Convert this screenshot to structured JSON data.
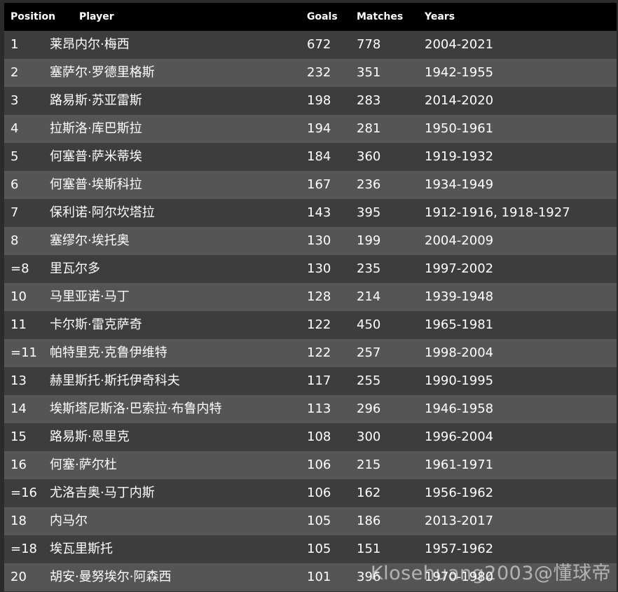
{
  "table": {
    "headers": {
      "position": "Position",
      "player": "Player",
      "goals": "Goals",
      "matches": "Matches",
      "years": "Years"
    },
    "rows": [
      {
        "position": "1",
        "player": "莱昂内尔·梅西",
        "goals": "672",
        "matches": "778",
        "years": "2004-2021"
      },
      {
        "position": "2",
        "player": "塞萨尔·罗德里格斯",
        "goals": "232",
        "matches": "351",
        "years": "1942-1955"
      },
      {
        "position": "3",
        "player": "路易斯·苏亚雷斯",
        "goals": "198",
        "matches": "283",
        "years": "2014-2020"
      },
      {
        "position": "4",
        "player": "拉斯洛·库巴斯拉",
        "goals": "194",
        "matches": "281",
        "years": "1950-1961"
      },
      {
        "position": "5",
        "player": "何塞普·萨米蒂埃",
        "goals": "184",
        "matches": "360",
        "years": "1919-1932"
      },
      {
        "position": "6",
        "player": "何塞普·埃斯科拉",
        "goals": "167",
        "matches": "236",
        "years": "1934-1949"
      },
      {
        "position": "7",
        "player": "保利诺·阿尔坎塔拉",
        "goals": "143",
        "matches": "395",
        "years": "1912-1916, 1918-1927"
      },
      {
        "position": "8",
        "player": "塞缪尔·埃托奥",
        "goals": "130",
        "matches": "199",
        "years": "2004-2009"
      },
      {
        "position": "=8",
        "player": "里瓦尔多",
        "goals": "130",
        "matches": "235",
        "years": "1997-2002"
      },
      {
        "position": "10",
        "player": "马里亚诺·马丁",
        "goals": "128",
        "matches": "214",
        "years": "1939-1948"
      },
      {
        "position": "11",
        "player": "卡尔斯·雷克萨奇",
        "goals": "122",
        "matches": "450",
        "years": "1965-1981"
      },
      {
        "position": "=11",
        "player": "帕特里克·克鲁伊维特",
        "goals": "122",
        "matches": "257",
        "years": "1998-2004"
      },
      {
        "position": "13",
        "player": "赫里斯托·斯托伊奇科夫",
        "goals": "117",
        "matches": "255",
        "years": "1990-1995"
      },
      {
        "position": "14",
        "player": "埃斯塔尼斯洛·巴索拉·布鲁内特",
        "goals": "113",
        "matches": "296",
        "years": "1946-1958"
      },
      {
        "position": "15",
        "player": "路易斯·恩里克",
        "goals": "108",
        "matches": "300",
        "years": "1996-2004"
      },
      {
        "position": "16",
        "player": "何塞·萨尔杜",
        "goals": "106",
        "matches": "215",
        "years": "1961-1971"
      },
      {
        "position": "=16",
        "player": "尤洛吉奥·马丁内斯",
        "goals": "106",
        "matches": "162",
        "years": "1956-1962"
      },
      {
        "position": "18",
        "player": "内马尔",
        "goals": "105",
        "matches": "186",
        "years": "2013-2017"
      },
      {
        "position": "=18",
        "player": "埃瓦里斯托",
        "goals": "105",
        "matches": "151",
        "years": "1957-1962"
      },
      {
        "position": "20",
        "player": "胡安·曼努埃尔·阿森西",
        "goals": "101",
        "matches": "396",
        "years": "1970-1980"
      }
    ]
  },
  "watermark": "Klosehuang2003@懂球帝",
  "colors": {
    "header_bg": "#000000",
    "row_odd": "#3d3d3d",
    "row_even": "#555555",
    "text": "#ffffff"
  }
}
